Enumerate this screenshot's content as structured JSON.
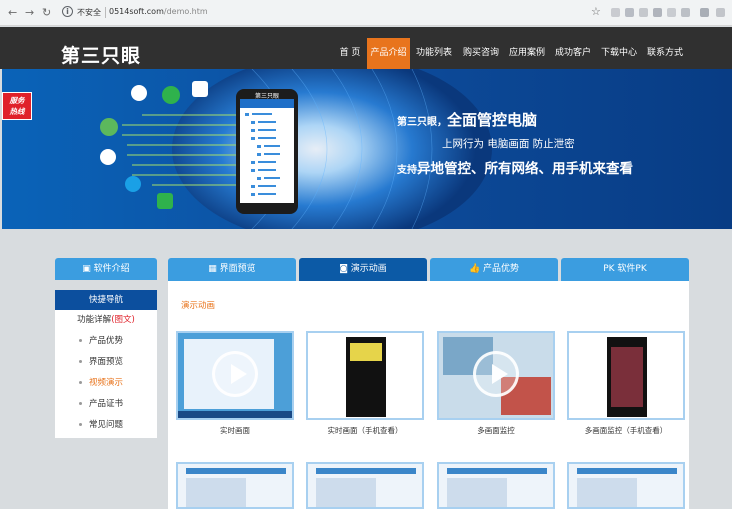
{
  "browser": {
    "security_label": "不安全",
    "url_host": "0514soft.com",
    "url_path": "/demo.htm",
    "back_icon": "arrow-left-icon",
    "forward_icon": "arrow-right-icon",
    "reload_icon": "reload-icon",
    "star_icon": "star-icon"
  },
  "site": {
    "logo": "第三只眼",
    "nav": [
      "首 页",
      "产品介绍",
      "功能列表",
      "购买咨询",
      "应用案例",
      "成功客户",
      "下载中心",
      "联系方式"
    ],
    "active_nav": 1
  },
  "banner": {
    "line1_prefix": "第三只眼，",
    "line1_main": "全面管控电脑",
    "line2": "上网行为  电脑画面  防止泄密",
    "line3_prefix": "支持",
    "line3_main": "异地管控、所有网络、用手机来查看",
    "phone_title": "第三只眼"
  },
  "service_badge": [
    "服务",
    "热线"
  ],
  "sidebar": {
    "header": "软件介绍",
    "quick_nav": "快捷导航",
    "detail_label": "功能详解",
    "detail_suffix": "(图文)",
    "items": [
      "产品优势",
      "界面预览",
      "视频演示",
      "产品证书",
      "常见问题"
    ],
    "active_item": 2
  },
  "tabs": [
    {
      "label": "界面预览",
      "icon": "ui-preview-icon"
    },
    {
      "label": "演示动画",
      "icon": "camera-icon"
    },
    {
      "label": "产品优势",
      "icon": "thumbs-up-icon"
    },
    {
      "label": "软件PK",
      "icon": "pk-icon"
    }
  ],
  "active_tab": 1,
  "content": {
    "title": "演示动画",
    "videos": [
      {
        "caption": "实时画面"
      },
      {
        "caption": "实时画面（手机查看）"
      },
      {
        "caption": "多画面监控"
      },
      {
        "caption": "多画面监控（手机查看）"
      }
    ]
  },
  "colors": {
    "accent_orange": "#e8741d",
    "tab_blue": "#3b9de0",
    "active_blue": "#0c5aa6",
    "header_dark": "#303030"
  }
}
